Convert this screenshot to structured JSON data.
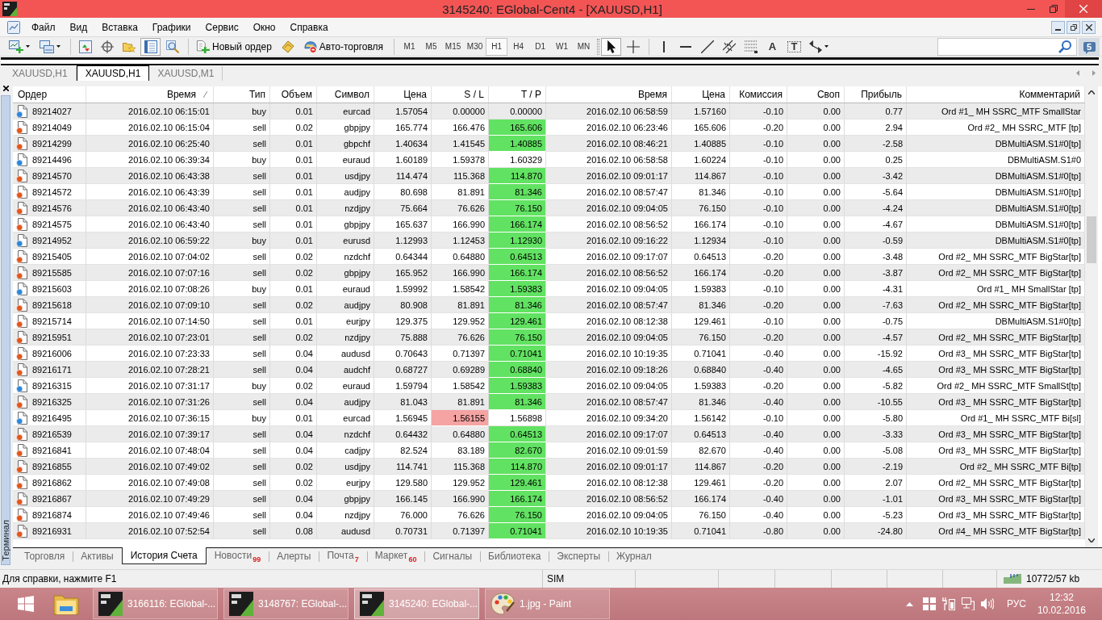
{
  "window": {
    "title": "3145240: EGlobal-Cent4 - [XAUUSD,H1]"
  },
  "menu": [
    "Файл",
    "Вид",
    "Вставка",
    "Графики",
    "Сервис",
    "Окно",
    "Справка"
  ],
  "toolbar": {
    "panels": [
      {
        "kind": "market-watch",
        "selected": false
      },
      {
        "kind": "data-window",
        "selected": false
      },
      {
        "kind": "navigator",
        "selected": false
      },
      {
        "kind": "terminal",
        "selected": true
      },
      {
        "kind": "tester",
        "selected": false
      }
    ],
    "new_order": "Новый ордер",
    "autotrading": "Авто-торговля",
    "timeframes": [
      {
        "label": "M1",
        "selected": false
      },
      {
        "label": "M5",
        "selected": false
      },
      {
        "label": "M15",
        "selected": false
      },
      {
        "label": "M30",
        "selected": false
      },
      {
        "label": "H1",
        "selected": true
      },
      {
        "label": "H4",
        "selected": false
      },
      {
        "label": "D1",
        "selected": false
      },
      {
        "label": "W1",
        "selected": false
      },
      {
        "label": "MN",
        "selected": false
      }
    ],
    "tools": [
      {
        "kind": "cursor",
        "selected": true
      },
      {
        "kind": "crosshair",
        "selected": false
      },
      {
        "kind": "vline",
        "selected": false
      },
      {
        "kind": "hline",
        "selected": false
      },
      {
        "kind": "trendline",
        "selected": false
      },
      {
        "kind": "channel",
        "selected": false
      },
      {
        "kind": "fibo",
        "selected": false
      },
      {
        "kind": "text",
        "glyph": "A",
        "selected": false
      },
      {
        "kind": "label",
        "glyph": "T",
        "selected": false
      },
      {
        "kind": "arrows",
        "selected": false
      }
    ],
    "messages": "5"
  },
  "chart_tabs": [
    {
      "label": "XAUUSD,H1",
      "selected": false
    },
    {
      "label": "XAUUSD,H1",
      "selected": true
    },
    {
      "label": "XAUUSD,M1",
      "selected": false
    }
  ],
  "terminal": {
    "title": "Терминал",
    "columns": [
      {
        "label": "Ордер",
        "sorted": false
      },
      {
        "label": "Время",
        "sorted": true
      },
      {
        "label": "Тип",
        "sorted": false
      },
      {
        "label": "Объем",
        "sorted": false
      },
      {
        "label": "Символ",
        "sorted": false
      },
      {
        "label": "Цена",
        "sorted": false
      },
      {
        "label": "S / L",
        "sorted": false
      },
      {
        "label": "T / P",
        "sorted": false
      },
      {
        "label": "Время",
        "sorted": false
      },
      {
        "label": "Цена",
        "sorted": false
      },
      {
        "label": "Комиссия",
        "sorted": false
      },
      {
        "label": "Своп",
        "sorted": false
      },
      {
        "label": "Прибыль",
        "sorted": false
      },
      {
        "label": "Комментарий",
        "sorted": false
      }
    ],
    "rows": [
      {
        "order": "89214027",
        "open_time": "2016.02.10 06:15:01",
        "type": "buy",
        "volume": "0.01",
        "symbol": "eurcad",
        "open_price": "1.57054",
        "sl": "0.00000",
        "tp": "0.00000",
        "close_time": "2016.02.10 06:58:59",
        "close_price": "1.57160",
        "commission": "-0.10",
        "swap": "0.00",
        "profit": "0.77",
        "comment": "Ord #1_ MH SSRC_MTF SmallStar",
        "kind": "buy",
        "sl_hit": false,
        "tp_hit": false
      },
      {
        "order": "89214049",
        "open_time": "2016.02.10 06:15:04",
        "type": "sell",
        "volume": "0.02",
        "symbol": "gbpjpy",
        "open_price": "165.774",
        "sl": "166.476",
        "tp": "165.606",
        "close_time": "2016.02.10 06:23:46",
        "close_price": "165.606",
        "commission": "-0.20",
        "swap": "0.00",
        "profit": "2.94",
        "comment": "Ord #2_ MH SSRC_MTF [tp]",
        "kind": "sell",
        "sl_hit": false,
        "tp_hit": true
      },
      {
        "order": "89214299",
        "open_time": "2016.02.10 06:25:40",
        "type": "sell",
        "volume": "0.01",
        "symbol": "gbpchf",
        "open_price": "1.40634",
        "sl": "1.41545",
        "tp": "1.40885",
        "close_time": "2016.02.10 08:46:21",
        "close_price": "1.40885",
        "commission": "-0.10",
        "swap": "0.00",
        "profit": "-2.58",
        "comment": "DBMultiASM.S1#0[tp]",
        "kind": "sell",
        "sl_hit": false,
        "tp_hit": true
      },
      {
        "order": "89214496",
        "open_time": "2016.02.10 06:39:34",
        "type": "buy",
        "volume": "0.01",
        "symbol": "euraud",
        "open_price": "1.60189",
        "sl": "1.59378",
        "tp": "1.60329",
        "close_time": "2016.02.10 06:58:58",
        "close_price": "1.60224",
        "commission": "-0.10",
        "swap": "0.00",
        "profit": "0.25",
        "comment": "DBMultiASM.S1#0",
        "kind": "buy",
        "sl_hit": false,
        "tp_hit": false
      },
      {
        "order": "89214570",
        "open_time": "2016.02.10 06:43:38",
        "type": "sell",
        "volume": "0.01",
        "symbol": "usdjpy",
        "open_price": "114.474",
        "sl": "115.368",
        "tp": "114.870",
        "close_time": "2016.02.10 09:01:17",
        "close_price": "114.867",
        "commission": "-0.10",
        "swap": "0.00",
        "profit": "-3.42",
        "comment": "DBMultiASM.S1#0[tp]",
        "kind": "sell",
        "sl_hit": false,
        "tp_hit": true
      },
      {
        "order": "89214572",
        "open_time": "2016.02.10 06:43:39",
        "type": "sell",
        "volume": "0.01",
        "symbol": "audjpy",
        "open_price": "80.698",
        "sl": "81.891",
        "tp": "81.346",
        "close_time": "2016.02.10 08:57:47",
        "close_price": "81.346",
        "commission": "-0.10",
        "swap": "0.00",
        "profit": "-5.64",
        "comment": "DBMultiASM.S1#0[tp]",
        "kind": "sell",
        "sl_hit": false,
        "tp_hit": true
      },
      {
        "order": "89214576",
        "open_time": "2016.02.10 06:43:40",
        "type": "sell",
        "volume": "0.01",
        "symbol": "nzdjpy",
        "open_price": "75.664",
        "sl": "76.626",
        "tp": "76.150",
        "close_time": "2016.02.10 09:04:05",
        "close_price": "76.150",
        "commission": "-0.10",
        "swap": "0.00",
        "profit": "-4.24",
        "comment": "DBMultiASM.S1#0[tp]",
        "kind": "sell",
        "sl_hit": false,
        "tp_hit": true
      },
      {
        "order": "89214575",
        "open_time": "2016.02.10 06:43:40",
        "type": "sell",
        "volume": "0.01",
        "symbol": "gbpjpy",
        "open_price": "165.637",
        "sl": "166.990",
        "tp": "166.174",
        "close_time": "2016.02.10 08:56:52",
        "close_price": "166.174",
        "commission": "-0.10",
        "swap": "0.00",
        "profit": "-4.67",
        "comment": "DBMultiASM.S1#0[tp]",
        "kind": "sell",
        "sl_hit": false,
        "tp_hit": true
      },
      {
        "order": "89214952",
        "open_time": "2016.02.10 06:59:22",
        "type": "buy",
        "volume": "0.01",
        "symbol": "eurusd",
        "open_price": "1.12993",
        "sl": "1.12453",
        "tp": "1.12930",
        "close_time": "2016.02.10 09:16:22",
        "close_price": "1.12934",
        "commission": "-0.10",
        "swap": "0.00",
        "profit": "-0.59",
        "comment": "DBMultiASM.S1#0[tp]",
        "kind": "buy",
        "sl_hit": false,
        "tp_hit": true
      },
      {
        "order": "89215405",
        "open_time": "2016.02.10 07:04:02",
        "type": "sell",
        "volume": "0.02",
        "symbol": "nzdchf",
        "open_price": "0.64344",
        "sl": "0.64880",
        "tp": "0.64513",
        "close_time": "2016.02.10 09:17:07",
        "close_price": "0.64513",
        "commission": "-0.20",
        "swap": "0.00",
        "profit": "-3.48",
        "comment": "Ord #2_ MH SSRC_MTF BigStar[tp]",
        "kind": "sell",
        "sl_hit": false,
        "tp_hit": true
      },
      {
        "order": "89215585",
        "open_time": "2016.02.10 07:07:16",
        "type": "sell",
        "volume": "0.02",
        "symbol": "gbpjpy",
        "open_price": "165.952",
        "sl": "166.990",
        "tp": "166.174",
        "close_time": "2016.02.10 08:56:52",
        "close_price": "166.174",
        "commission": "-0.20",
        "swap": "0.00",
        "profit": "-3.87",
        "comment": "Ord #2_ MH SSRC_MTF BigStar[tp]",
        "kind": "sell",
        "sl_hit": false,
        "tp_hit": true
      },
      {
        "order": "89215603",
        "open_time": "2016.02.10 07:08:26",
        "type": "buy",
        "volume": "0.01",
        "symbol": "euraud",
        "open_price": "1.59992",
        "sl": "1.58542",
        "tp": "1.59383",
        "close_time": "2016.02.10 09:04:05",
        "close_price": "1.59383",
        "commission": "-0.10",
        "swap": "0.00",
        "profit": "-4.31",
        "comment": "Ord #1_ MH SmallStar [tp]",
        "kind": "buy",
        "sl_hit": false,
        "tp_hit": true
      },
      {
        "order": "89215618",
        "open_time": "2016.02.10 07:09:10",
        "type": "sell",
        "volume": "0.02",
        "symbol": "audjpy",
        "open_price": "80.908",
        "sl": "81.891",
        "tp": "81.346",
        "close_time": "2016.02.10 08:57:47",
        "close_price": "81.346",
        "commission": "-0.20",
        "swap": "0.00",
        "profit": "-7.63",
        "comment": "Ord #2_ MH SSRC_MTF BigStar[tp]",
        "kind": "sell",
        "sl_hit": false,
        "tp_hit": true
      },
      {
        "order": "89215714",
        "open_time": "2016.02.10 07:14:50",
        "type": "sell",
        "volume": "0.01",
        "symbol": "eurjpy",
        "open_price": "129.375",
        "sl": "129.952",
        "tp": "129.461",
        "close_time": "2016.02.10 08:12:38",
        "close_price": "129.461",
        "commission": "-0.10",
        "swap": "0.00",
        "profit": "-0.75",
        "comment": "DBMultiASM.S1#0[tp]",
        "kind": "sell",
        "sl_hit": false,
        "tp_hit": true
      },
      {
        "order": "89215951",
        "open_time": "2016.02.10 07:23:01",
        "type": "sell",
        "volume": "0.02",
        "symbol": "nzdjpy",
        "open_price": "75.888",
        "sl": "76.626",
        "tp": "76.150",
        "close_time": "2016.02.10 09:04:05",
        "close_price": "76.150",
        "commission": "-0.20",
        "swap": "0.00",
        "profit": "-4.57",
        "comment": "Ord #2_ MH SSRC_MTF BigStar[tp]",
        "kind": "sell",
        "sl_hit": false,
        "tp_hit": true
      },
      {
        "order": "89216006",
        "open_time": "2016.02.10 07:23:33",
        "type": "sell",
        "volume": "0.04",
        "symbol": "audusd",
        "open_price": "0.70643",
        "sl": "0.71397",
        "tp": "0.71041",
        "close_time": "2016.02.10 10:19:35",
        "close_price": "0.71041",
        "commission": "-0.40",
        "swap": "0.00",
        "profit": "-15.92",
        "comment": "Ord #3_ MH SSRC_MTF BigStar[tp]",
        "kind": "sell",
        "sl_hit": false,
        "tp_hit": true
      },
      {
        "order": "89216171",
        "open_time": "2016.02.10 07:28:21",
        "type": "sell",
        "volume": "0.04",
        "symbol": "audchf",
        "open_price": "0.68727",
        "sl": "0.69289",
        "tp": "0.68840",
        "close_time": "2016.02.10 09:18:26",
        "close_price": "0.68840",
        "commission": "-0.40",
        "swap": "0.00",
        "profit": "-4.65",
        "comment": "Ord #3_ MH SSRC_MTF BigStar[tp]",
        "kind": "sell",
        "sl_hit": false,
        "tp_hit": true
      },
      {
        "order": "89216315",
        "open_time": "2016.02.10 07:31:17",
        "type": "buy",
        "volume": "0.02",
        "symbol": "euraud",
        "open_price": "1.59794",
        "sl": "1.58542",
        "tp": "1.59383",
        "close_time": "2016.02.10 09:04:05",
        "close_price": "1.59383",
        "commission": "-0.20",
        "swap": "0.00",
        "profit": "-5.82",
        "comment": "Ord #2_ MH SSRC_MTF SmallSt[tp]",
        "kind": "buy",
        "sl_hit": false,
        "tp_hit": true
      },
      {
        "order": "89216325",
        "open_time": "2016.02.10 07:31:26",
        "type": "sell",
        "volume": "0.04",
        "symbol": "audjpy",
        "open_price": "81.043",
        "sl": "81.891",
        "tp": "81.346",
        "close_time": "2016.02.10 08:57:47",
        "close_price": "81.346",
        "commission": "-0.40",
        "swap": "0.00",
        "profit": "-10.55",
        "comment": "Ord #3_ MH SSRC_MTF BigStar[tp]",
        "kind": "sell",
        "sl_hit": false,
        "tp_hit": true
      },
      {
        "order": "89216495",
        "open_time": "2016.02.10 07:36:15",
        "type": "buy",
        "volume": "0.01",
        "symbol": "eurcad",
        "open_price": "1.56945",
        "sl": "1.56155",
        "tp": "1.56898",
        "close_time": "2016.02.10 09:34:20",
        "close_price": "1.56142",
        "commission": "-0.10",
        "swap": "0.00",
        "profit": "-5.80",
        "comment": "Ord #1_ MH SSRC_MTF Bi[sl]",
        "kind": "buy",
        "sl_hit": true,
        "tp_hit": false
      },
      {
        "order": "89216539",
        "open_time": "2016.02.10 07:39:17",
        "type": "sell",
        "volume": "0.04",
        "symbol": "nzdchf",
        "open_price": "0.64432",
        "sl": "0.64880",
        "tp": "0.64513",
        "close_time": "2016.02.10 09:17:07",
        "close_price": "0.64513",
        "commission": "-0.40",
        "swap": "0.00",
        "profit": "-3.33",
        "comment": "Ord #3_ MH SSRC_MTF BigStar[tp]",
        "kind": "sell",
        "sl_hit": false,
        "tp_hit": true
      },
      {
        "order": "89216841",
        "open_time": "2016.02.10 07:48:04",
        "type": "sell",
        "volume": "0.04",
        "symbol": "cadjpy",
        "open_price": "82.524",
        "sl": "83.189",
        "tp": "82.670",
        "close_time": "2016.02.10 09:01:59",
        "close_price": "82.670",
        "commission": "-0.40",
        "swap": "0.00",
        "profit": "-5.08",
        "comment": "Ord #3_ MH SSRC_MTF BigStar[tp]",
        "kind": "sell",
        "sl_hit": false,
        "tp_hit": true
      },
      {
        "order": "89216855",
        "open_time": "2016.02.10 07:49:02",
        "type": "sell",
        "volume": "0.02",
        "symbol": "usdjpy",
        "open_price": "114.741",
        "sl": "115.368",
        "tp": "114.870",
        "close_time": "2016.02.10 09:01:17",
        "close_price": "114.867",
        "commission": "-0.20",
        "swap": "0.00",
        "profit": "-2.19",
        "comment": "Ord #2_ MH SSRC_MTF Bi[tp]",
        "kind": "sell",
        "sl_hit": false,
        "tp_hit": true
      },
      {
        "order": "89216862",
        "open_time": "2016.02.10 07:49:08",
        "type": "sell",
        "volume": "0.02",
        "symbol": "eurjpy",
        "open_price": "129.580",
        "sl": "129.952",
        "tp": "129.461",
        "close_time": "2016.02.10 08:12:38",
        "close_price": "129.461",
        "commission": "-0.20",
        "swap": "0.00",
        "profit": "2.07",
        "comment": "Ord #2_ MH SSRC_MTF BigStar[tp]",
        "kind": "sell",
        "sl_hit": false,
        "tp_hit": true
      },
      {
        "order": "89216867",
        "open_time": "2016.02.10 07:49:29",
        "type": "sell",
        "volume": "0.04",
        "symbol": "gbpjpy",
        "open_price": "166.145",
        "sl": "166.990",
        "tp": "166.174",
        "close_time": "2016.02.10 08:56:52",
        "close_price": "166.174",
        "commission": "-0.40",
        "swap": "0.00",
        "profit": "-1.01",
        "comment": "Ord #3_ MH SSRC_MTF BigStar[tp]",
        "kind": "sell",
        "sl_hit": false,
        "tp_hit": true
      },
      {
        "order": "89216874",
        "open_time": "2016.02.10 07:49:46",
        "type": "sell",
        "volume": "0.04",
        "symbol": "nzdjpy",
        "open_price": "76.000",
        "sl": "76.626",
        "tp": "76.150",
        "close_time": "2016.02.10 09:04:05",
        "close_price": "76.150",
        "commission": "-0.40",
        "swap": "0.00",
        "profit": "-5.23",
        "comment": "Ord #3_ MH SSRC_MTF BigStar[tp]",
        "kind": "sell",
        "sl_hit": false,
        "tp_hit": true
      },
      {
        "order": "89216931",
        "open_time": "2016.02.10 07:52:54",
        "type": "sell",
        "volume": "0.08",
        "symbol": "audusd",
        "open_price": "0.70731",
        "sl": "0.71397",
        "tp": "0.71041",
        "close_time": "2016.02.10 10:19:35",
        "close_price": "0.71041",
        "commission": "-0.80",
        "swap": "0.00",
        "profit": "-24.80",
        "comment": "Ord #4_ MH SSRC_MTF BigStar[tp]",
        "kind": "sell",
        "sl_hit": false,
        "tp_hit": true
      }
    ],
    "tabs": [
      {
        "label": "Торговля",
        "selected": false
      },
      {
        "label": "Активы",
        "selected": false
      },
      {
        "label": "История Счета",
        "selected": true
      },
      {
        "label": "Новости",
        "badge": "99",
        "selected": false
      },
      {
        "label": "Алерты",
        "selected": false
      },
      {
        "label": "Почта",
        "badge": "7",
        "selected": false
      },
      {
        "label": "Маркет",
        "badge": "60",
        "selected": false
      },
      {
        "label": "Сигналы",
        "selected": false
      },
      {
        "label": "Библиотека",
        "selected": false
      },
      {
        "label": "Эксперты",
        "selected": false
      },
      {
        "label": "Журнал",
        "selected": false
      }
    ]
  },
  "status_bar": {
    "help": "Для справки, нажмите F1",
    "server": "SIM",
    "traffic": "10772/57 kb"
  },
  "taskbar": {
    "buttons": [
      {
        "kind": "app",
        "label": "3166116: EGlobal-...",
        "selected": false
      },
      {
        "kind": "app",
        "label": "3148767: EGlobal-...",
        "selected": false
      },
      {
        "kind": "app",
        "label": "3145240: EGlobal-...",
        "selected": true
      },
      {
        "kind": "paint",
        "label": "1.jpg - Paint",
        "selected": false
      }
    ],
    "language": "РУС",
    "time": "12:32",
    "date": "10.02.2016"
  }
}
